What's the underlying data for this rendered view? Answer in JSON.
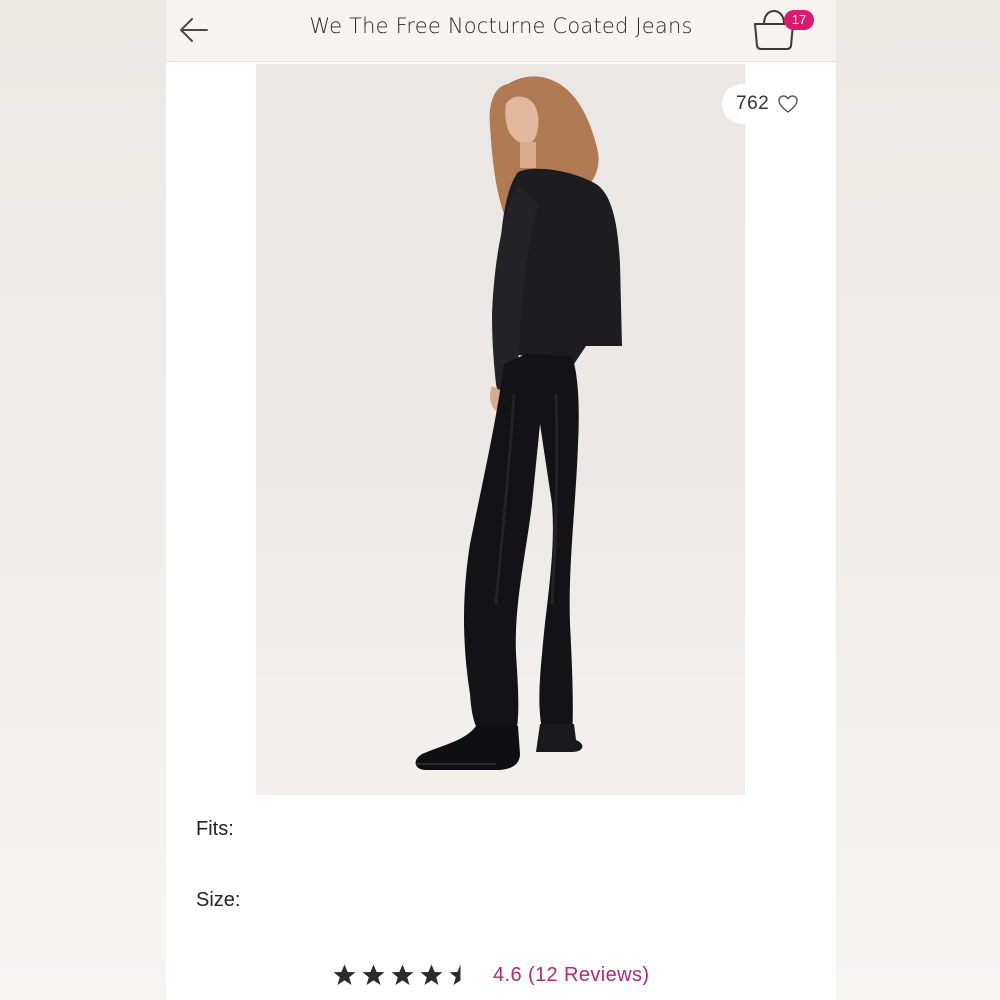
{
  "header": {
    "title": "We The Free Nocturne Coated Jeans",
    "bag_count": "17"
  },
  "product": {
    "likes": "762",
    "fits_label": "Fits:",
    "size_label": "Size:",
    "rating_stars": 4.5,
    "rating_text": "4.6 (12 Reviews)"
  },
  "colors": {
    "badge": "#d81b6e",
    "rating_text": "#b0287d",
    "star": "#2b2b2b"
  }
}
